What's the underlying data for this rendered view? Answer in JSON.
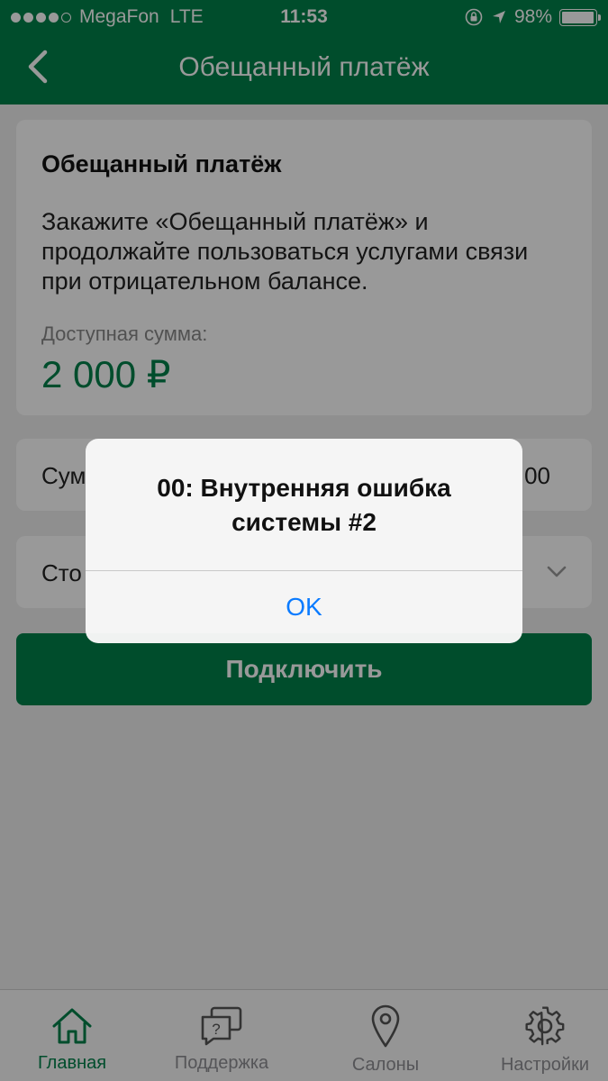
{
  "status_bar": {
    "carrier": "MegaFon",
    "network": "LTE",
    "time": "11:53",
    "battery": "98%",
    "battery_level": 0.98
  },
  "nav": {
    "title": "Обещанный платёж",
    "back_icon": "chevron-left-icon"
  },
  "info_card": {
    "title": "Обещанный платёж",
    "description": "Закажите «Обещанный платёж» и продолжайте пользоваться услугами связи при отрицательном балансе.",
    "available_label": "Доступная сумма:",
    "available_value": "2 000 ₽"
  },
  "fields": {
    "sum_label": "Сум",
    "sum_value": "00",
    "term_label": "Сто"
  },
  "connect_button": "Подключить",
  "alert": {
    "title": "00: Внутренняя ошибка системы #2",
    "ok": "OK"
  },
  "tabs": [
    {
      "label": "Главная",
      "icon": "home-icon",
      "active": true
    },
    {
      "label": "Поддержка",
      "icon": "support-chat-icon",
      "active": false
    },
    {
      "label": "Салоны",
      "icon": "location-pin-icon",
      "active": false
    },
    {
      "label": "Настройки",
      "icon": "gear-icon",
      "active": false
    }
  ],
  "colors": {
    "brand": "#00804a",
    "alert_button": "#0a7bff"
  }
}
